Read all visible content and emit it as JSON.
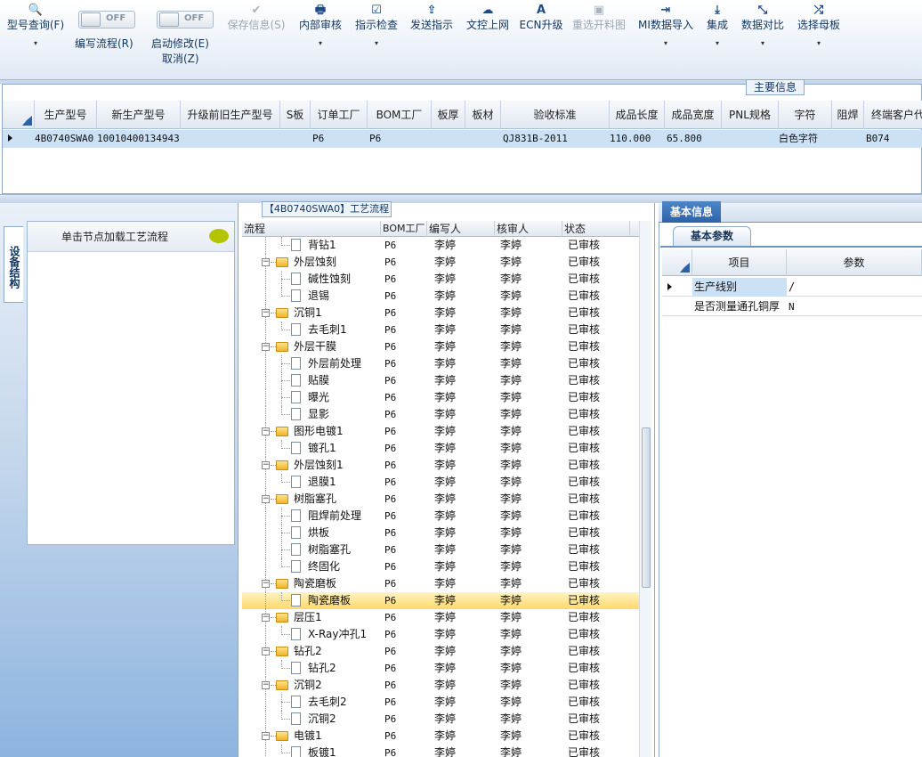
{
  "toolbar": {
    "items": [
      {
        "icon": "search-icon",
        "glyph": "🔍",
        "label": "型号查询(F)",
        "dropdown": "▾",
        "disabled": false
      },
      {
        "icon": "check-icon",
        "glyph": "✔",
        "label": "保存信息(S)",
        "dropdown": "",
        "disabled": true
      },
      {
        "icon": "print-icon",
        "glyph": "🖶",
        "label": "内部审核",
        "dropdown": "▾",
        "disabled": false
      },
      {
        "icon": "checkbox-icon",
        "glyph": "☑",
        "label": "指示检查",
        "dropdown": "▾",
        "disabled": false
      },
      {
        "icon": "upload-icon",
        "glyph": "⇪",
        "label": "发送指示",
        "dropdown": "",
        "disabled": false
      },
      {
        "icon": "cloud-upload-icon",
        "glyph": "☁",
        "label": "文控上网",
        "dropdown": "",
        "disabled": false
      },
      {
        "icon": "font-icon",
        "glyph": "A",
        "label": "ECN升级",
        "dropdown": "",
        "disabled": false
      },
      {
        "icon": "image-icon",
        "glyph": "▣",
        "label": "重选开料图",
        "dropdown": "",
        "disabled": true
      },
      {
        "icon": "import-icon",
        "glyph": "⇥",
        "label": "MI数据导入",
        "dropdown": "▾",
        "disabled": false
      },
      {
        "icon": "download-icon",
        "glyph": "⤓",
        "label": "集成",
        "dropdown": "▾",
        "disabled": false
      },
      {
        "icon": "compare-icon",
        "glyph": "⤡",
        "label": "数据对比",
        "dropdown": "▾",
        "disabled": false
      },
      {
        "icon": "shuffle-icon",
        "glyph": "⤮",
        "label": "选择母板",
        "dropdown": "▾",
        "disabled": false
      }
    ],
    "toggle1": {
      "state": "OFF",
      "label": "编写流程(R)"
    },
    "toggle2": {
      "state": "OFF",
      "label": "启动修改(E)",
      "label2": "取消(Z)"
    }
  },
  "main_info": {
    "title": "主要信息",
    "columns": [
      "生产型号",
      "新生产型号",
      "升级前旧生产型号",
      "S板",
      "订单工厂",
      "BOM工厂",
      "板厚",
      "板材",
      "验收标准",
      "成品长度",
      "成品宽度",
      "PNL规格",
      "字符",
      "阻焊",
      "终端客户代"
    ],
    "row": [
      "4B0740SWA0",
      "10010400134943",
      "",
      "",
      "P6",
      "P6",
      "",
      "",
      "QJ831B-2011",
      "110.000",
      "65.800",
      "",
      "白色字符",
      "",
      "B074"
    ]
  },
  "left_panel": {
    "vertical_tab": "设备结构",
    "header": "单击节点加载工艺流程"
  },
  "flow": {
    "title": "【4B0740SWA0】工艺流程",
    "columns": [
      "流程",
      "BOM工厂",
      "编写人",
      "核审人",
      "状态"
    ],
    "rows": [
      {
        "level": 2,
        "name": "背钻1",
        "bom": "P6",
        "writer": "李婷",
        "reviewer": "李婷",
        "status": "已审核"
      },
      {
        "level": 1,
        "name": "外层蚀刻",
        "bom": "P6",
        "writer": "李婷",
        "reviewer": "李婷",
        "status": "已审核"
      },
      {
        "level": 2,
        "name": "碱性蚀刻",
        "bom": "P6",
        "writer": "李婷",
        "reviewer": "李婷",
        "status": "已审核"
      },
      {
        "level": 2,
        "name": "退锡",
        "bom": "P6",
        "writer": "李婷",
        "reviewer": "李婷",
        "status": "已审核"
      },
      {
        "level": 1,
        "name": "沉铜1",
        "bom": "P6",
        "writer": "李婷",
        "reviewer": "李婷",
        "status": "已审核"
      },
      {
        "level": 2,
        "name": "去毛刺1",
        "bom": "P6",
        "writer": "李婷",
        "reviewer": "李婷",
        "status": "已审核"
      },
      {
        "level": 1,
        "name": "外层干膜",
        "bom": "P6",
        "writer": "李婷",
        "reviewer": "李婷",
        "status": "已审核"
      },
      {
        "level": 2,
        "name": "外层前处理",
        "bom": "P6",
        "writer": "李婷",
        "reviewer": "李婷",
        "status": "已审核"
      },
      {
        "level": 2,
        "name": "贴膜",
        "bom": "P6",
        "writer": "李婷",
        "reviewer": "李婷",
        "status": "已审核"
      },
      {
        "level": 2,
        "name": "曝光",
        "bom": "P6",
        "writer": "李婷",
        "reviewer": "李婷",
        "status": "已审核"
      },
      {
        "level": 2,
        "name": "显影",
        "bom": "P6",
        "writer": "李婷",
        "reviewer": "李婷",
        "status": "已审核"
      },
      {
        "level": 1,
        "name": "图形电镀1",
        "bom": "P6",
        "writer": "李婷",
        "reviewer": "李婷",
        "status": "已审核"
      },
      {
        "level": 2,
        "name": "镀孔1",
        "bom": "P6",
        "writer": "李婷",
        "reviewer": "李婷",
        "status": "已审核"
      },
      {
        "level": 1,
        "name": "外层蚀刻1",
        "bom": "P6",
        "writer": "李婷",
        "reviewer": "李婷",
        "status": "已审核"
      },
      {
        "level": 2,
        "name": "退膜1",
        "bom": "P6",
        "writer": "李婷",
        "reviewer": "李婷",
        "status": "已审核"
      },
      {
        "level": 1,
        "name": "树脂塞孔",
        "bom": "P6",
        "writer": "李婷",
        "reviewer": "李婷",
        "status": "已审核"
      },
      {
        "level": 2,
        "name": "阻焊前处理",
        "bom": "P6",
        "writer": "李婷",
        "reviewer": "李婷",
        "status": "已审核"
      },
      {
        "level": 2,
        "name": "烘板",
        "bom": "P6",
        "writer": "李婷",
        "reviewer": "李婷",
        "status": "已审核"
      },
      {
        "level": 2,
        "name": "树脂塞孔",
        "bom": "P6",
        "writer": "李婷",
        "reviewer": "李婷",
        "status": "已审核"
      },
      {
        "level": 2,
        "name": "终固化",
        "bom": "P6",
        "writer": "李婷",
        "reviewer": "李婷",
        "status": "已审核"
      },
      {
        "level": 1,
        "name": "陶瓷磨板",
        "bom": "P6",
        "writer": "李婷",
        "reviewer": "李婷",
        "status": "已审核"
      },
      {
        "level": 2,
        "name": "陶瓷磨板",
        "bom": "P6",
        "writer": "李婷",
        "reviewer": "李婷",
        "status": "已审核",
        "selected": true
      },
      {
        "level": 1,
        "name": "层压1",
        "bom": "P6",
        "writer": "李婷",
        "reviewer": "李婷",
        "status": "已审核"
      },
      {
        "level": 2,
        "name": "X-Ray冲孔1",
        "bom": "P6",
        "writer": "李婷",
        "reviewer": "李婷",
        "status": "已审核"
      },
      {
        "level": 1,
        "name": "钻孔2",
        "bom": "P6",
        "writer": "李婷",
        "reviewer": "李婷",
        "status": "已审核"
      },
      {
        "level": 2,
        "name": "钻孔2",
        "bom": "P6",
        "writer": "李婷",
        "reviewer": "李婷",
        "status": "已审核"
      },
      {
        "level": 1,
        "name": "沉铜2",
        "bom": "P6",
        "writer": "李婷",
        "reviewer": "李婷",
        "status": "已审核"
      },
      {
        "level": 2,
        "name": "去毛刺2",
        "bom": "P6",
        "writer": "李婷",
        "reviewer": "李婷",
        "status": "已审核"
      },
      {
        "level": 2,
        "name": "沉铜2",
        "bom": "P6",
        "writer": "李婷",
        "reviewer": "李婷",
        "status": "已审核"
      },
      {
        "level": 1,
        "name": "电镀1",
        "bom": "P6",
        "writer": "李婷",
        "reviewer": "李婷",
        "status": "已审核"
      },
      {
        "level": 2,
        "name": "板镀1",
        "bom": "P6",
        "writer": "李婷",
        "reviewer": "李婷",
        "status": "已审核"
      }
    ]
  },
  "right_panel": {
    "tab": "基本信息",
    "subtab": "基本参数",
    "columns": [
      "项目",
      "参数"
    ],
    "rows": [
      {
        "item": "生产线别",
        "value": "/"
      },
      {
        "item": "是否测量通孔铜厚",
        "value": "N"
      }
    ]
  }
}
